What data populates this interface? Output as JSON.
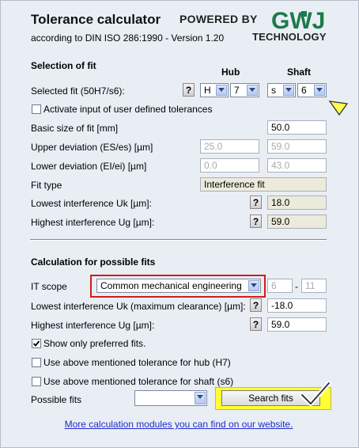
{
  "header": {
    "title": "Tolerance calculator",
    "subtitle": "according to DIN ISO 286:1990 - Version 1.20",
    "powered_by": "POWERED BY",
    "logo_text": "GWJ",
    "technology": "TECHNOLOGY"
  },
  "selection": {
    "heading": "Selection of fit",
    "hub_label": "Hub",
    "shaft_label": "Shaft",
    "selected_fit_label": "Selected fit (50H7/s6):",
    "help": "?",
    "hub_letter": "H",
    "hub_grade": "7",
    "shaft_letter": "s",
    "shaft_grade": "6",
    "user_defined_label": "Activate input of user defined tolerances",
    "basic_size_label": "Basic size of fit [mm]",
    "basic_size_value": "50.0",
    "upper_dev_label": "Upper deviation (ES/es) [µm]",
    "upper_hub": "25.0",
    "upper_shaft": "59.0",
    "lower_dev_label": "Lower deviation (EI/ei) [µm]",
    "lower_hub": "0.0",
    "lower_shaft": "43.0",
    "fit_type_label": "Fit type",
    "fit_type_value": "Interference fit",
    "lowest_label": "Lowest interference Uk [µm]:",
    "lowest_value": "18.0",
    "highest_label": "Highest interference Ug [µm]:",
    "highest_value": "59.0"
  },
  "calculation": {
    "heading": "Calculation for possible fits",
    "it_scope_label": "IT scope",
    "it_scope_value": "Common mechanical engineering",
    "it_from": "6",
    "it_dash": "-",
    "it_to": "11",
    "lowest_label": "Lowest interference Uk (maximum clearance) [µm]:",
    "lowest_value": "-18.0",
    "highest_label": "Highest interference Ug [µm]:",
    "highest_value": "59.0",
    "preferred_label": "Show only preferred fits.",
    "preferred_checked": true,
    "hub_tol_label": "Use above mentioned tolerance for hub (H7)",
    "shaft_tol_label": "Use above mentioned tolerance for shaft (s6)",
    "possible_fits_label": "Possible fits",
    "possible_fits_value": "",
    "search_button": "Search fits"
  },
  "footer": {
    "link_text": "More calculation modules you can find on our website."
  },
  "colors": {
    "accent_green": "#1d7a4a",
    "highlight": "#ffff33",
    "annotation_red": "#d01c1c"
  }
}
